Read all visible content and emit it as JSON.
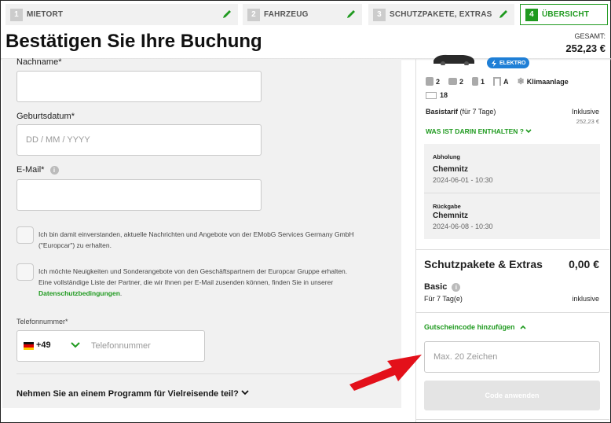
{
  "steps": [
    {
      "num": "1",
      "label": "MIETORT"
    },
    {
      "num": "2",
      "label": "FAHRZEUG"
    },
    {
      "num": "3",
      "label": "SCHUTZPAKETE, EXTRAS"
    },
    {
      "num": "4",
      "label": "ÜBERSICHT"
    }
  ],
  "header": {
    "title": "Bestätigen Sie Ihre Buchung",
    "total_label": "GESAMT:",
    "total_value": "252,23 €"
  },
  "form": {
    "lastname_label": "Nachname*",
    "birth_label": "Geburtsdatum*",
    "birth_placeholder": "DD / MM / YYYY",
    "email_label": "E-Mail*",
    "consent1_line1": "Ich bin damit einverstanden, aktuelle Nachrichten und Angebote von der EMobG Services Germany GmbH",
    "consent1_line2": "(\"Europcar\") zu erhalten.",
    "consent2_line1": "Ich möchte Neuigkeiten und Sonderangebote von den Geschäftspartnern der Europcar Gruppe erhalten.",
    "consent2_line2": "Eine vollständige Liste der Partner, die wir Ihnen per E-Mail zusenden können, finden Sie in unserer",
    "consent2_link": "Datenschutzbedingungen",
    "phone_label": "Telefonnummer*",
    "phone_code": "+49",
    "phone_placeholder": "Telefonnummer",
    "loyalty": "Nehmen Sie an einem Programm für Vielreisende teil?"
  },
  "summary": {
    "badge": "ELEKTRO",
    "specs": {
      "seats": "2",
      "bags": "2",
      "small_bags": "1",
      "transmission": "A",
      "ac": "Klimaanlage",
      "doors": "18"
    },
    "tariff_label": "Basistarif",
    "tariff_detail": "(für 7 Tage)",
    "tariff_value": "Inklusive",
    "tariff_price": "252,23 €",
    "included_link": "WAS IST DARIN ENTHALTEN ?",
    "pickup_label": "Abholung",
    "pickup_city": "Chemnitz",
    "pickup_date": "2024-06-01 - 10:30",
    "return_label": "Rückgabe",
    "return_city": "Chemnitz",
    "return_date": "2024-06-08 - 10:30",
    "extras_title": "Schutzpakete & Extras",
    "extras_value": "0,00 €",
    "basic_label": "Basic",
    "basic_detail": "Für 7 Tag(e)",
    "basic_value": "inklusive",
    "voucher_link": "Gutscheincode hinzufügen",
    "voucher_placeholder": "Max. 20 Zeichen",
    "apply_button": "Code anwenden"
  },
  "colors": {
    "accent": "#1f9a1f",
    "arrow": "#e3101a",
    "electro": "#1f7fd6"
  }
}
